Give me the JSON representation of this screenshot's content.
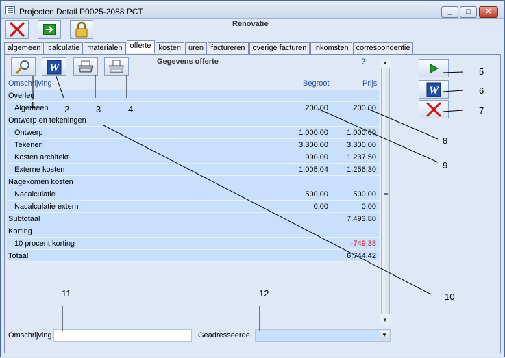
{
  "window": {
    "title": "Projecten Detail   P0025-2088   PCT",
    "subtitle": "Renovatie",
    "minimize": "_",
    "maximize": "□",
    "close": "✕"
  },
  "toolbar": [
    {
      "name": "cancel",
      "icon": "red-x-icon"
    },
    {
      "name": "save-exit",
      "icon": "green-arrow-icon"
    },
    {
      "name": "lock",
      "icon": "lock-icon"
    }
  ],
  "tabs": [
    "algemeen",
    "calculatie",
    "materialen",
    "offerte",
    "kosten",
    "uren",
    "factureren",
    "overige facturen",
    "inkomsten",
    "correspondentie"
  ],
  "active_tab": "offerte",
  "offerte": {
    "section_title": "Gegevens offerte",
    "help": "?",
    "columns": {
      "omschrijving": "Omschrijving",
      "begroot": "Begroot",
      "prijs": "Prijs"
    },
    "rows": [
      {
        "label": "Overleg",
        "begroot": "",
        "prijs": "",
        "indent": false
      },
      {
        "label": "Algemeen",
        "begroot": "200,00",
        "prijs": "200,00",
        "indent": true
      },
      {
        "label": "Ontwerp en tekeningen",
        "begroot": "",
        "prijs": "",
        "indent": false
      },
      {
        "label": "Ontwerp",
        "begroot": "1.000,00",
        "prijs": "1.000,00",
        "indent": true
      },
      {
        "label": "Tekenen",
        "begroot": "3.300,00",
        "prijs": "3.300,00",
        "indent": true
      },
      {
        "label": "Kosten architekt",
        "begroot": "990,00",
        "prijs": "1.237,50",
        "indent": true
      },
      {
        "label": "Externe kosten",
        "begroot": "1.005,04",
        "prijs": "1.256,30",
        "indent": true
      },
      {
        "label": "Nagekomen kosten",
        "begroot": "",
        "prijs": "",
        "indent": false
      },
      {
        "label": "Nacalculatie",
        "begroot": "500,00",
        "prijs": "500,00",
        "indent": true
      },
      {
        "label": "Nacalculatie extern",
        "begroot": "0,00",
        "prijs": "0,00",
        "indent": true
      },
      {
        "label": "Subtotaal",
        "begroot": "",
        "prijs": "7.493,80",
        "indent": false
      },
      {
        "label": "Korting",
        "begroot": "",
        "prijs": "",
        "indent": false
      },
      {
        "label": "10 procent korting",
        "begroot": "",
        "prijs": "-749,38",
        "indent": true,
        "negative": true
      },
      {
        "label": "Totaal",
        "begroot": "",
        "prijs": "6.744,42",
        "indent": false
      }
    ],
    "omschrijving_label": "Omschrijving",
    "omschrijving_value": "",
    "geadresseerde_label": "Geadresseerde",
    "geadresseerde_value": ""
  },
  "callouts": [
    "1",
    "2",
    "3",
    "4",
    "5",
    "6",
    "7",
    "8",
    "9",
    "10",
    "11",
    "12"
  ],
  "colors": {
    "row_bg": "#c8e0fb",
    "negative": "#d8001a",
    "header_text": "#2a4fa0"
  }
}
